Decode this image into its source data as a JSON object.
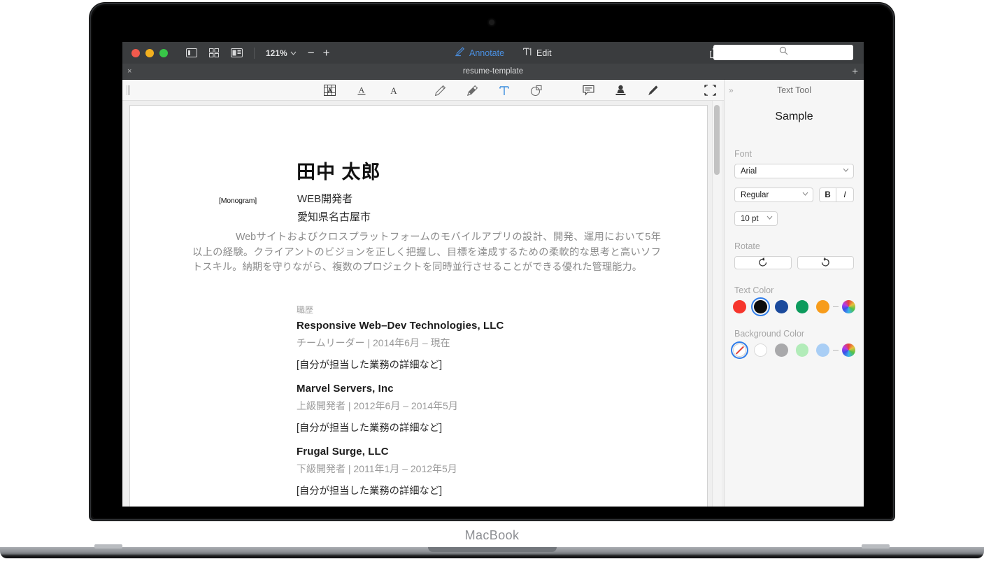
{
  "device": {
    "wordmark": "MacBook"
  },
  "window": {
    "titlebar": {
      "traffic_lights": [
        "close",
        "minimize",
        "zoom"
      ],
      "view_icons": [
        "sidebar-view-icon",
        "grid-view-icon",
        "split-view-icon"
      ],
      "zoom_level": "121%",
      "zoom_chevron": "⌄",
      "zoom_out": "−",
      "zoom_in": "+",
      "modes": [
        {
          "id": "annotate",
          "label": "Annotate",
          "icon": "annotate-pen-icon",
          "active": true,
          "color": "#4a90e2"
        },
        {
          "id": "edit",
          "label": "Edit",
          "icon": "text-cursor-icon",
          "active": false
        }
      ],
      "share_icon": "share-icon",
      "search": {
        "placeholder": "",
        "value": "",
        "icon": "search-icon"
      }
    },
    "tabbar": {
      "close_label": "×",
      "tab_title": "resume-template",
      "add_label": "+"
    },
    "annotation_toolbar": {
      "tools": [
        {
          "id": "ocr",
          "name": "ocr-text-icon",
          "active": false
        },
        {
          "id": "underline-text",
          "name": "underline-text-icon",
          "active": false
        },
        {
          "id": "text-style",
          "name": "text-style-icon",
          "active": false
        },
        {
          "id": "pencil",
          "name": "pencil-icon",
          "active": false
        },
        {
          "id": "highlighter",
          "name": "highlighter-icon",
          "active": false
        },
        {
          "id": "text",
          "name": "text-tool-icon",
          "active": true
        },
        {
          "id": "shapes",
          "name": "shapes-icon",
          "active": false
        },
        {
          "id": "note",
          "name": "note-icon",
          "active": false
        },
        {
          "id": "stamp",
          "name": "stamp-icon",
          "active": false
        },
        {
          "id": "signature",
          "name": "signature-icon",
          "active": false
        },
        {
          "id": "crop",
          "name": "crop-select-icon",
          "active": false
        }
      ],
      "active_tool_color": "#3a8dde"
    }
  },
  "document": {
    "monogram": "[Monogram]",
    "name": "田中 太郎",
    "role": "WEB開発者",
    "location": "愛知県名古屋市",
    "summary": "Webサイトおよびクロスプラットフォームのモバイルアプリの設計、開発、運用において5年以上の経験。クライアントのビジョンを正しく把握し、目標を達成するための柔軟的な思考と高いソフトスキル。納期を守りながら、複数のプロジェクトを同時並行させることができる優れた管理能力。",
    "section_label": "職歴",
    "jobs": [
      {
        "company": "Responsive Web–Dev Technologies, LLC",
        "meta": "チームリーダー | 2014年6月 – 現在",
        "description": "[自分が担当した業務の詳細など]"
      },
      {
        "company": "Marvel Servers, Inc",
        "meta": "上級開発者 | 2012年6月 – 2014年5月",
        "description": "[自分が担当した業務の詳細など]"
      },
      {
        "company": "Frugal Surge, LLC",
        "meta": "下級開発者 | 2011年1月 – 2012年5月",
        "description": "[自分が担当した業務の詳細など]"
      }
    ]
  },
  "sidebar": {
    "collapse_icon": "»",
    "title": "Text Tool",
    "sample_text": "Sample",
    "font_label": "Font",
    "font_family": "Arial",
    "font_style": "Regular",
    "bold_label": "B",
    "italic_label": "I",
    "font_size": "10 pt",
    "rotate_label": "Rotate",
    "rotate_ccw_icon": "↺",
    "rotate_cw_icon": "↻",
    "text_color_label": "Text Color",
    "text_colors": [
      {
        "name": "red",
        "hex": "#f6352c",
        "selected": false
      },
      {
        "name": "black",
        "hex": "#0d0d0d",
        "selected": true
      },
      {
        "name": "blue",
        "hex": "#1b4a9c",
        "selected": false
      },
      {
        "name": "green",
        "hex": "#0d9b5d",
        "selected": false
      },
      {
        "name": "orange",
        "hex": "#f79c1b",
        "selected": false
      },
      {
        "name": "color-wheel",
        "hex": "wheel",
        "selected": false
      }
    ],
    "background_color_label": "Background Color",
    "background_colors": [
      {
        "name": "no-fill",
        "hex": "none",
        "selected": true
      },
      {
        "name": "white",
        "hex": "#ffffff",
        "selected": false
      },
      {
        "name": "gray",
        "hex": "#a9a9ab",
        "selected": false
      },
      {
        "name": "light-green",
        "hex": "#b2ecb9",
        "selected": false
      },
      {
        "name": "light-blue",
        "hex": "#a9cef5",
        "selected": false
      },
      {
        "name": "color-wheel",
        "hex": "wheel",
        "selected": false
      }
    ],
    "chevron": "⌄"
  }
}
